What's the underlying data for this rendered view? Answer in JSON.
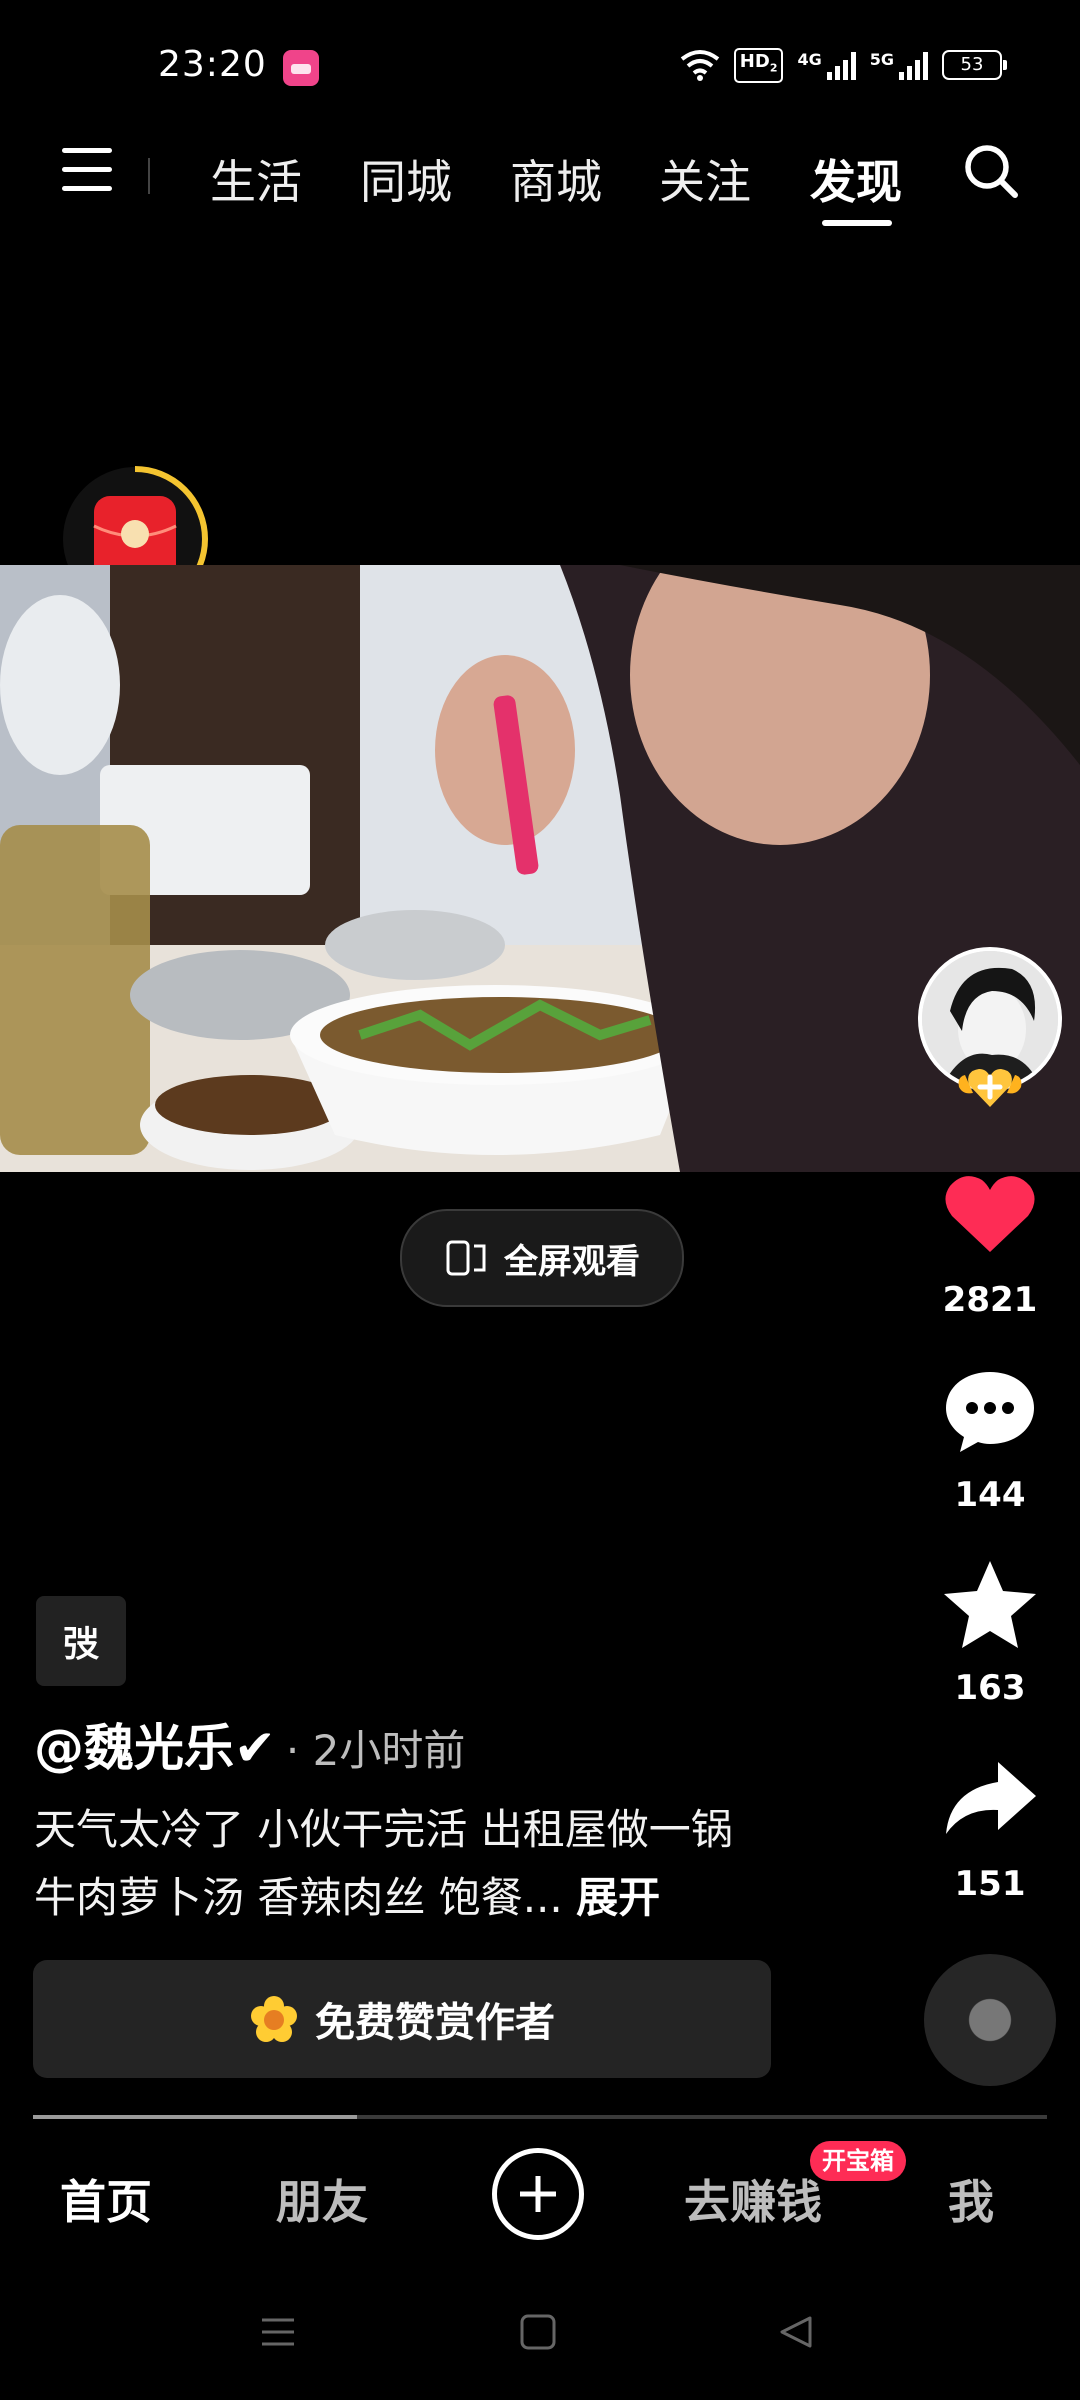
{
  "status_bar": {
    "time": "23:20",
    "hd_label": "HD",
    "hd_sub": "2",
    "net1": "4G",
    "net2": "5G",
    "battery": "53"
  },
  "top_nav": {
    "tabs": [
      {
        "label": "生活"
      },
      {
        "label": "同城"
      },
      {
        "label": "商城"
      },
      {
        "label": "关注"
      },
      {
        "label": "发现"
      }
    ],
    "active_tab": "发现"
  },
  "video": {
    "fullscreen_label": "全屏观看"
  },
  "right_rail": {
    "likes": "2821",
    "comments": "144",
    "favorites": "163",
    "shares": "151",
    "like_color": "#fe2c55"
  },
  "post": {
    "tag_label": "弢",
    "author": "@魏光乐✔",
    "time": "· 2小时前",
    "caption": "天气太冷了 小伙干完活 出租屋做一锅牛肉萝卜汤 香辣肉丝 饱餐...",
    "expand_label": "展开",
    "tip_label": "免费赞赏作者",
    "progress": 0.32
  },
  "bottom_nav": {
    "tabs": [
      {
        "label": "首页"
      },
      {
        "label": "朋友"
      },
      {
        "label": "去赚钱"
      },
      {
        "label": "我"
      }
    ],
    "treasure_badge": "开宝箱"
  }
}
